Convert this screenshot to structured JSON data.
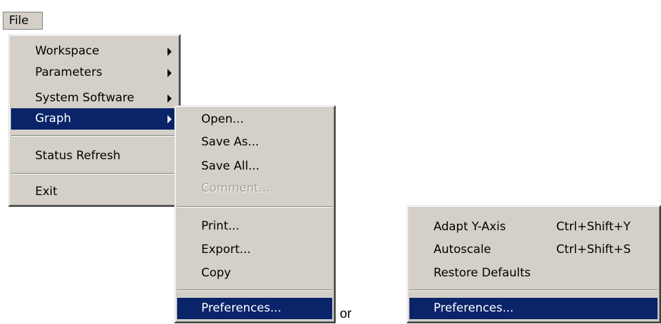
{
  "menubar": {
    "file_label": "File"
  },
  "file_menu": {
    "items": [
      {
        "label": "Workspace"
      },
      {
        "label": "Parameters"
      },
      {
        "label": "System Software"
      },
      {
        "label": "Graph"
      },
      {
        "label": "Status Refresh"
      },
      {
        "label": "Exit"
      }
    ]
  },
  "graph_menu": {
    "items": [
      {
        "label": "Open..."
      },
      {
        "label": "Save As..."
      },
      {
        "label": "Save All..."
      },
      {
        "label": "Comment..."
      },
      {
        "label": "Print..."
      },
      {
        "label": "Export..."
      },
      {
        "label": "Copy"
      },
      {
        "label": "Preferences..."
      }
    ]
  },
  "or_text": "or",
  "context_menu": {
    "items": [
      {
        "label": "Adapt Y-Axis",
        "shortcut": "Ctrl+Shift+Y"
      },
      {
        "label": "Autoscale",
        "shortcut": "Ctrl+Shift+S"
      },
      {
        "label": "Restore Defaults"
      },
      {
        "label": "Preferences..."
      }
    ]
  },
  "colors": {
    "menu_bg": "#d4d0c8",
    "highlight": "#0a246a",
    "highlight_text": "#ffffff",
    "disabled_text": "#a7a39c"
  }
}
